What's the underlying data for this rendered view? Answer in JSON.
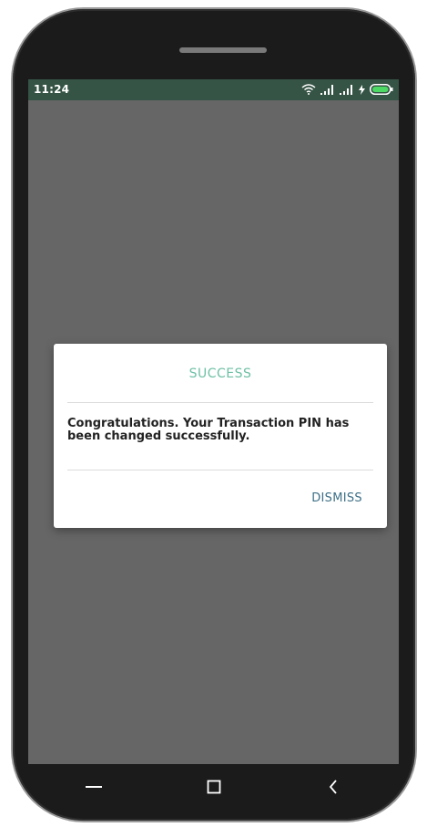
{
  "status_bar": {
    "time": "11:24",
    "icons": [
      "wifi-icon",
      "signal-icon",
      "signal-icon",
      "charging-icon",
      "battery-icon"
    ],
    "background": "#355445",
    "battery_color": "#4cd964"
  },
  "dialog": {
    "title": "SUCCESS",
    "message": "Congratulations. Your Transaction PIN has been changed successfully.",
    "dismiss_label": "DISMISS",
    "title_color": "#6ec0a6",
    "action_color": "#3d6f87"
  },
  "nav_bar": {
    "buttons": [
      "menu-icon",
      "home-icon",
      "back-icon"
    ]
  },
  "screen_background": "#666666"
}
